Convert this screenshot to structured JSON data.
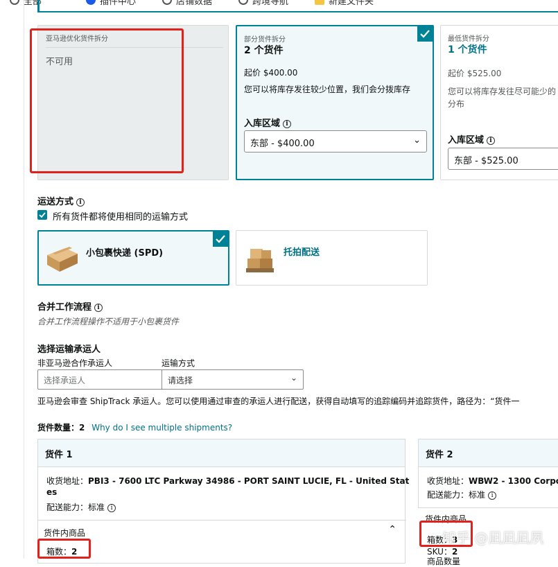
{
  "top_tabs": [
    {
      "label": "全部",
      "icon": "radio-icon"
    },
    {
      "label": "插件中心",
      "icon": "blue-circle-icon"
    },
    {
      "label": "店铺数据",
      "icon": "radio-icon"
    },
    {
      "label": "跨境导航",
      "icon": "radio-icon"
    },
    {
      "label": "新建文件夹",
      "icon": "folder-icon"
    }
  ],
  "options": {
    "opt1": {
      "label": "亚马逊优化货件拆分",
      "status": "不可用"
    },
    "opt2": {
      "label": "部分货件拆分",
      "count": "2 个货件",
      "price": "起价 $400.00",
      "desc": "您可以将库存发往较少位置，我们会分拨库存",
      "region_label": "入库区域",
      "region_value": "东部 - $400.00"
    },
    "opt3": {
      "label": "最低货件拆分",
      "count": "1 个货件",
      "price": "起价 $525.00",
      "desc1": "您可以将库存发往尽可能少的",
      "desc2": "分布",
      "region_label": "入库区域",
      "region_value": "东部 - $525.00"
    }
  },
  "shipping": {
    "title": "运送方式",
    "same_method": "所有货件都将使用相同的运输方式",
    "spd": "小包裹快递 (SPD)",
    "ltl": "托拍配送"
  },
  "workflow": {
    "title": "合并工作流程",
    "note": "合并工作流程操作不适用于小包裹货件"
  },
  "carrier": {
    "title": "选择运输承运人",
    "non_partner_label": "非亚马逊合作承运人",
    "method_label": "运输方式",
    "carrier_placeholder": "选择承运人",
    "method_placeholder": "请选择",
    "note": "亚马逊会审查 ShipTrack 承运人。您可以使用通过审查的承运人进行配送，获得自动填写的追踪编码并追踪货件，路径为：“货件一"
  },
  "shipment_count": {
    "label": "货件数量：",
    "value": "2",
    "link": "Why do I see multiple shipments?"
  },
  "shipments": [
    {
      "title": "货件 1",
      "address_label": "收货地址：",
      "address_line1": "PBI3 - 7600 LTC Parkway 34986 - PORT SAINT LUCIE, FL - United Stat",
      "address_line2": "es",
      "capacity_label": "配送能力：",
      "capacity_value": "标准",
      "items_label": "货件内商品",
      "boxes_label": "箱数：",
      "boxes_value": "2"
    },
    {
      "title": "货件 2",
      "address_label": "收货地址：",
      "address_line1": "WBW2 - 1300 Corpo",
      "capacity_label": "配送能力：",
      "capacity_value": "标准",
      "items_label": "货件内商品",
      "boxes_label": "箱数：",
      "boxes_value": "3",
      "sku_label": "SKU：",
      "sku_value": "2",
      "partial_label": "商品数量"
    }
  ],
  "watermark": "知乎 @凪凪凪夙",
  "colors": {
    "accent": "#008296",
    "link": "#007185",
    "highlight": "#e0211c"
  }
}
